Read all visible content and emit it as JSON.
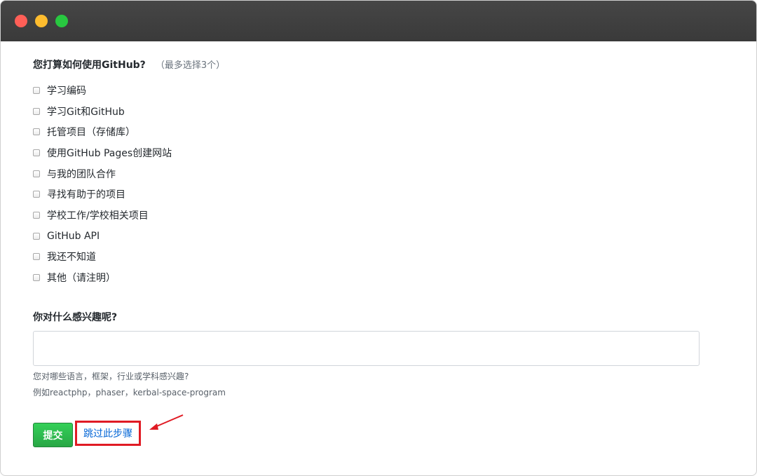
{
  "window": {
    "buttons": [
      {
        "name": "close",
        "color": "#ff5f57"
      },
      {
        "name": "minimize",
        "color": "#febc2e"
      },
      {
        "name": "maximize",
        "color": "#28c840"
      }
    ]
  },
  "usage_question": {
    "title": "您打算如何使用GitHub?",
    "note": "（最多选择3个）",
    "options": [
      "学习编码",
      "学习Git和GitHub",
      "托管项目（存储库）",
      "使用GitHub Pages创建网站",
      "与我的团队合作",
      "寻找有助于的项目",
      "学校工作/学校相关项目",
      "GitHub API",
      "我还不知道",
      "其他（请注明）"
    ]
  },
  "interest_question": {
    "title": "你对什么感兴趣呢?",
    "input_value": "",
    "hint1": "您对哪些语言，框架，行业或学科感兴趣?",
    "hint2": "例如reactphp，phaser，kerbal-space-program"
  },
  "actions": {
    "submit_label": "提交",
    "skip_label": "跳过此步骤"
  },
  "colors": {
    "accent_green": "#28a745",
    "link_blue": "#0366d6",
    "highlight_red": "#e01b24"
  }
}
